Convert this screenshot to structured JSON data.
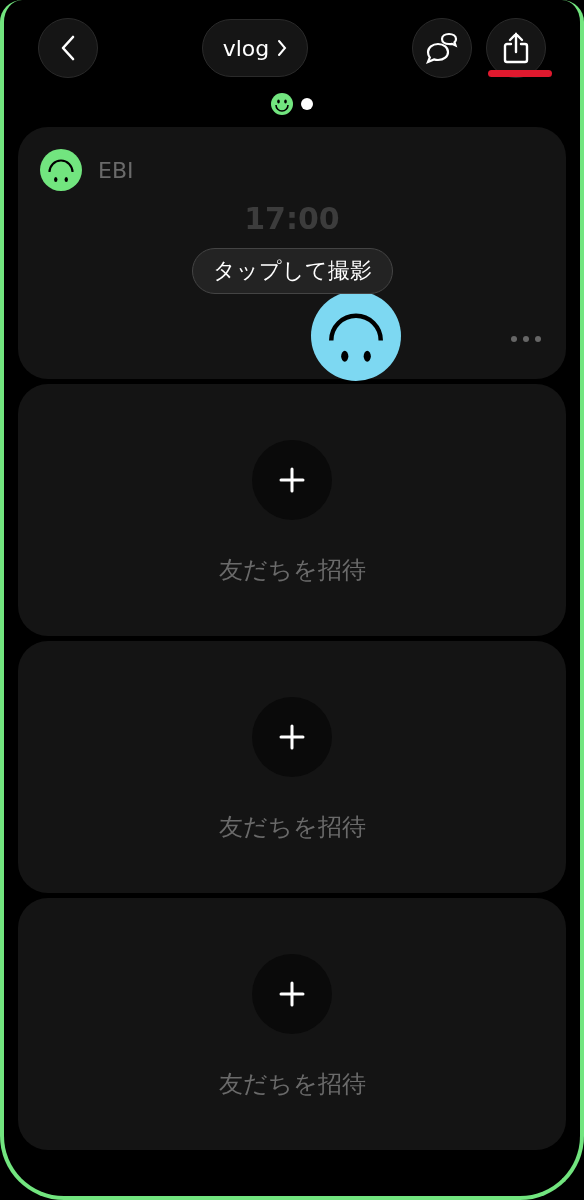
{
  "header": {
    "title": "vlog",
    "buttons": [
      {
        "kind": "chat",
        "highlighted": false
      },
      {
        "kind": "share",
        "highlighted": true
      }
    ]
  },
  "page_indicator": [
    {
      "kind": "smiley"
    },
    {
      "kind": "dot"
    }
  ],
  "capture_card": {
    "user": "EBI",
    "time": "17:00",
    "prompt": "タップして撮影"
  },
  "invite_slots": [
    {
      "label": "友だちを招待"
    },
    {
      "label": "友だちを招待"
    },
    {
      "label": "友だちを招待"
    }
  ]
}
